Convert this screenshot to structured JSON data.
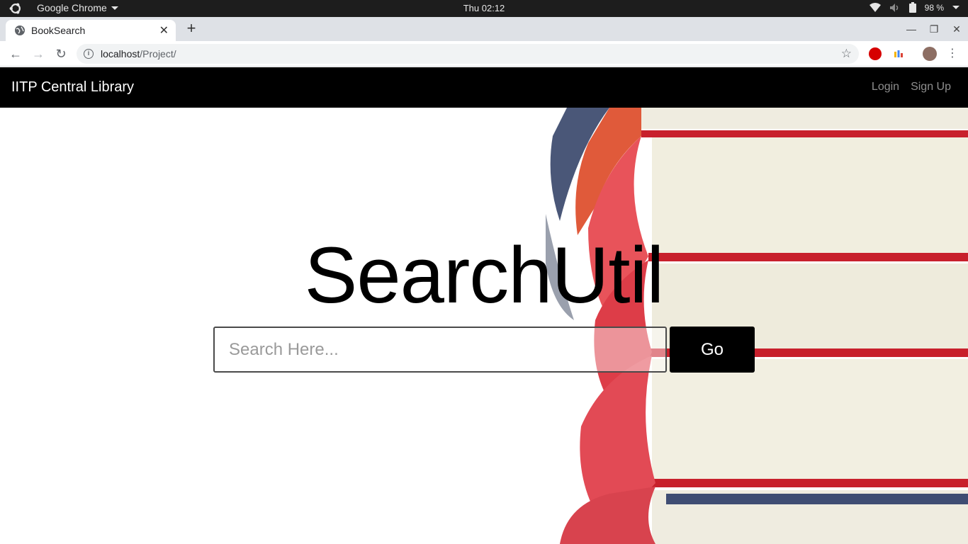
{
  "os": {
    "app_menu": "Google Chrome",
    "clock": "Thu 02:12",
    "battery": "98 %"
  },
  "browser": {
    "tab_title": "BookSearch",
    "url_host": "localhost",
    "url_path": "/Project/"
  },
  "site": {
    "brand": "IITP Central Library",
    "nav": {
      "login": "Login",
      "signup": "Sign Up"
    },
    "hero_title": "SearchUtil",
    "search_placeholder": "Search Here...",
    "go_label": "Go"
  },
  "colors": {
    "navbar": "#000000",
    "book_red": "#d9303a",
    "page_cream": "#f1eedf"
  },
  "icons": {
    "back": "arrow-left",
    "forward": "arrow-right",
    "reload": "reload",
    "bookmark": "star",
    "menu": "vertical-dots"
  }
}
